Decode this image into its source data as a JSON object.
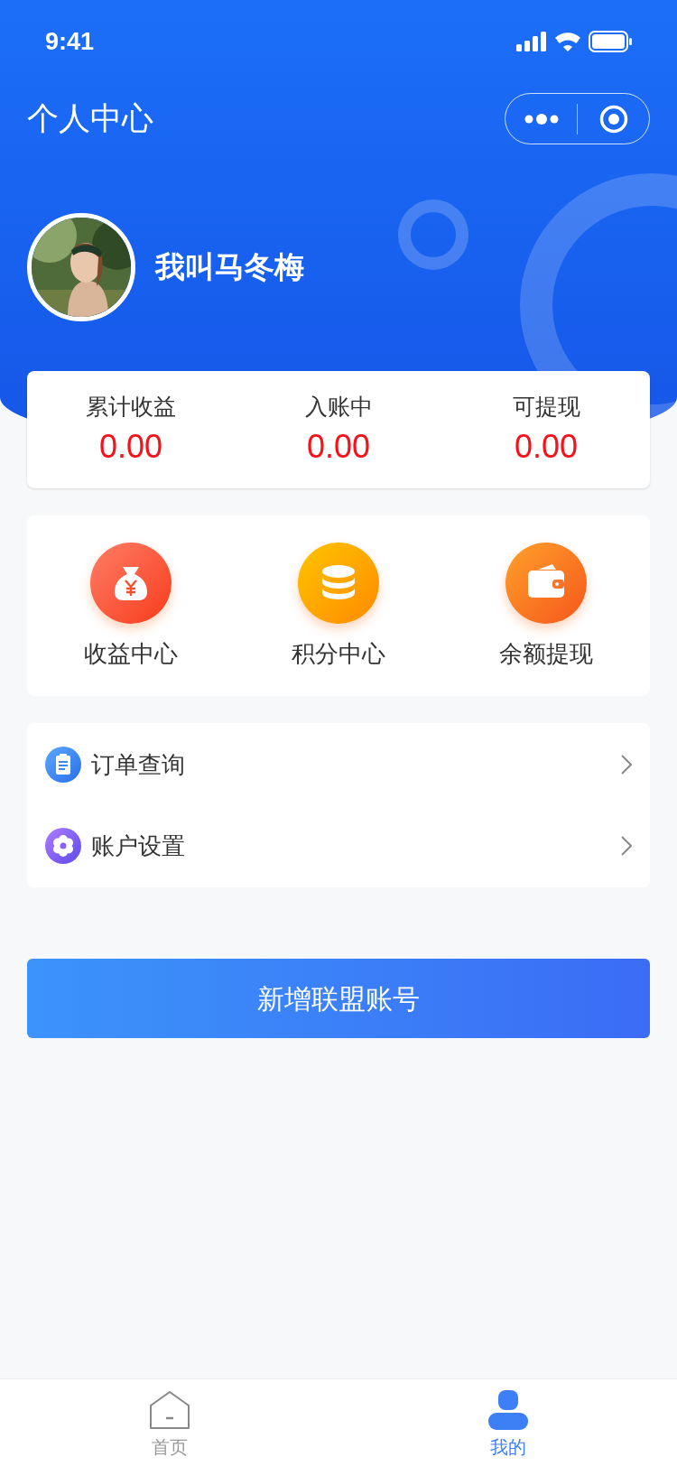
{
  "status_bar": {
    "time": "9:41"
  },
  "header": {
    "title": "个人中心"
  },
  "profile": {
    "name": "我叫马冬梅"
  },
  "stats": [
    {
      "label": "累计收益",
      "value": "0.00"
    },
    {
      "label": "入账中",
      "value": "0.00"
    },
    {
      "label": "可提现",
      "value": "0.00"
    }
  ],
  "shortcuts": [
    {
      "label": "收益中心",
      "kind": "money-bag"
    },
    {
      "label": "积分中心",
      "kind": "coins"
    },
    {
      "label": "余额提现",
      "kind": "wallet"
    }
  ],
  "menu": [
    {
      "label": "订单查询",
      "kind": "clipboard"
    },
    {
      "label": "账户设置",
      "kind": "gear"
    }
  ],
  "primary_button": {
    "label": "新增联盟账号"
  },
  "tab_bar": [
    {
      "label": "首页",
      "kind": "home",
      "selected": false
    },
    {
      "label": "我的",
      "kind": "person",
      "selected": true
    }
  ]
}
